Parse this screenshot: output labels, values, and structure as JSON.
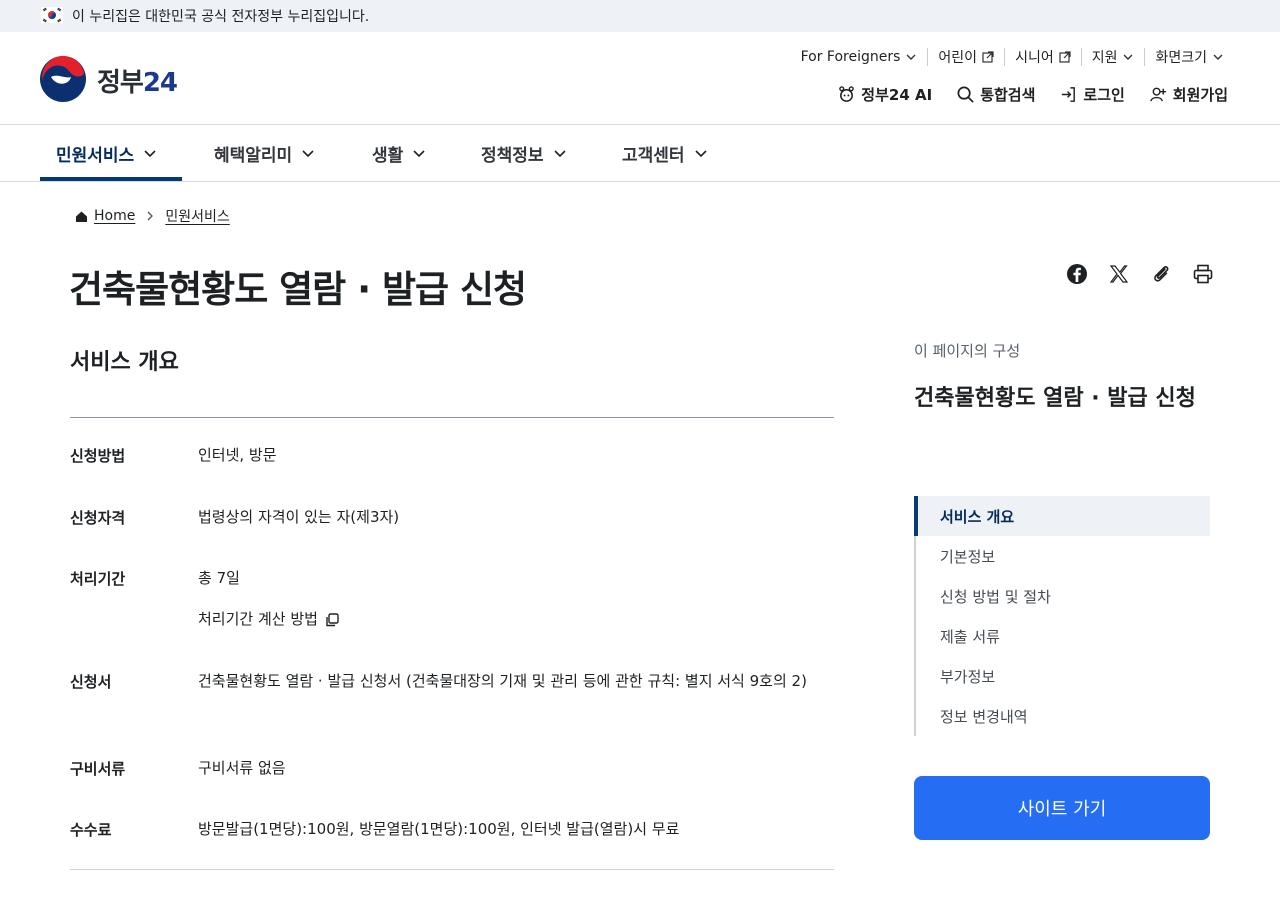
{
  "banner": {
    "text": "이 누리집은 대한민국 공식 전자정부 누리집입니다."
  },
  "header": {
    "logo_text": "정부",
    "logo_num": "24",
    "util_links": [
      {
        "label": "For Foreigners",
        "icon": "chevron-down-icon"
      },
      {
        "label": "어린이",
        "icon": "external-link-icon"
      },
      {
        "label": "시니어",
        "icon": "external-link-icon"
      },
      {
        "label": "지원",
        "icon": "chevron-down-icon"
      },
      {
        "label": "화면크기",
        "icon": "chevron-down-icon"
      }
    ],
    "actions": [
      {
        "label": "정부24 AI",
        "icon": "ai-bot-icon"
      },
      {
        "label": "통합검색",
        "icon": "search-icon"
      },
      {
        "label": "로그인",
        "icon": "login-icon"
      },
      {
        "label": "회원가입",
        "icon": "user-add-icon"
      }
    ]
  },
  "gnb": {
    "items": [
      {
        "label": "민원서비스",
        "active": true
      },
      {
        "label": "혜택알리미"
      },
      {
        "label": "생활"
      },
      {
        "label": "정책정보"
      },
      {
        "label": "고객센터"
      }
    ]
  },
  "breadcrumb": {
    "home": "Home",
    "current": "민원서비스"
  },
  "page": {
    "title": "건축물현황도 열람 · 발급 신청",
    "section_title": "서비스 개요",
    "rows": [
      {
        "label": "신청방법",
        "value": "인터넷, 방문"
      },
      {
        "label": "신청자격",
        "value": "법령상의 자격이 있는 자(제3자)"
      },
      {
        "label": "처리기간",
        "value": "총 7일",
        "sub": "처리기간 계산 방법"
      },
      {
        "label": "신청서",
        "value": "건축물현황도 열람 · 발급 신청서 (건축물대장의 기재 및 관리 등에 관한 규칙: 별지 서식 9호의 2)"
      },
      {
        "label": "구비서류",
        "value": "구비서류 없음"
      },
      {
        "label": "수수료",
        "value": "방문발급(1면당):100원, 방문열람(1면당):100원, 인터넷 발급(열람)시 무료"
      }
    ]
  },
  "share_icons": [
    "facebook-icon",
    "x-icon",
    "paperclip-icon",
    "print-icon"
  ],
  "toc": {
    "caption": "이 페이지의 구성",
    "title": "건축물현황도 열람 · 발급 신청",
    "links": [
      "서비스 개요",
      "기본정보",
      "신청 방법 및 절차",
      "제출 서류",
      "부가정보",
      "정보 변경내역"
    ],
    "current_index": 0
  },
  "cta": {
    "label": "사이트 가기"
  },
  "colors": {
    "primary": "#256ef4",
    "navy": "#063a74",
    "text": "#1e2124"
  }
}
